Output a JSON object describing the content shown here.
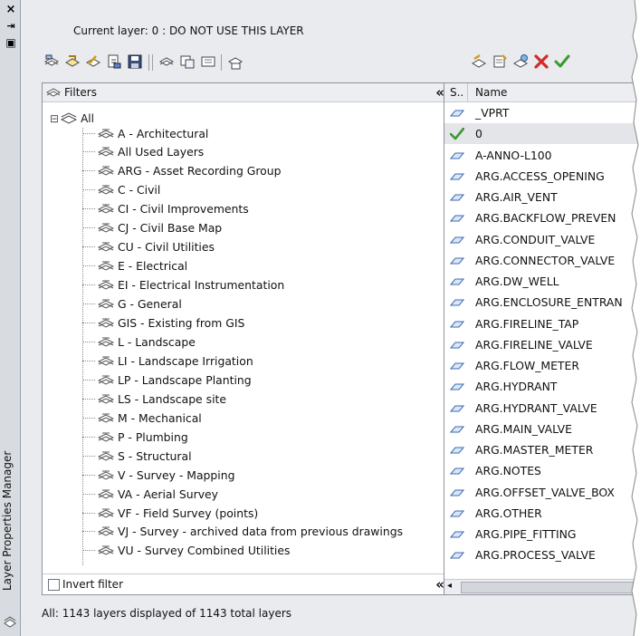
{
  "palette": {
    "title": "Layer Properties Manager",
    "close_glyph": "×",
    "autohide_glyph": "⇥",
    "properties_glyph": "▣"
  },
  "current_layer": "Current layer: 0 : DO NOT USE THIS LAYER",
  "toolbar": {
    "left_icons": [
      "new-property-filter-icon",
      "new-group-filter-icon",
      "layer-states-manager-icon",
      "layer-state-export-icon",
      "save-icon",
      "layer-filter-icon",
      "layer-filter-copy-icon",
      "layer-filter-merge-icon",
      "layer-filter-properties-icon"
    ],
    "right_icons": [
      "new-layer-icon",
      "new-layer-vp-frozen-icon",
      "delete-layer-icon",
      "set-current-icon"
    ],
    "delete_color": "#d12b2b",
    "current_color": "#3a9a2e"
  },
  "filters": {
    "header": "Filters",
    "collapse_glyph": "«",
    "root": "All",
    "expand_glyph": "⊟",
    "items": [
      "A - Architectural",
      "All Used Layers",
      "ARG - Asset Recording Group",
      "C - Civil",
      "CI - Civil Improvements",
      "CJ - Civil Base Map",
      "CU - Civil Utilities",
      "E - Electrical",
      "EI - Electrical Instrumentation",
      "G - General",
      "GIS - Existing from GIS",
      "L - Landscape",
      "LI - Landscape Irrigation",
      "LP - Landscape Planting",
      "LS - Landscape site",
      "M - Mechanical",
      "P - Plumbing",
      "S - Structural",
      "V - Survey - Mapping",
      "VA - Aerial Survey",
      "VF - Field Survey (points)",
      "VJ - Survey - archived data from previous drawings",
      "VU - Survey Combined Utilities"
    ],
    "invert_filter_label": "Invert filter",
    "invert_checked": false
  },
  "layers": {
    "col_status": "S..",
    "col_name": "Name",
    "rows": [
      {
        "name": "_VPRT",
        "current": false
      },
      {
        "name": "0",
        "current": true
      },
      {
        "name": "A-ANNO-L100",
        "current": false
      },
      {
        "name": "ARG.ACCESS_OPENING",
        "current": false
      },
      {
        "name": "ARG.AIR_VENT",
        "current": false
      },
      {
        "name": "ARG.BACKFLOW_PREVEN",
        "current": false
      },
      {
        "name": "ARG.CONDUIT_VALVE",
        "current": false
      },
      {
        "name": "ARG.CONNECTOR_VALVE",
        "current": false
      },
      {
        "name": "ARG.DW_WELL",
        "current": false
      },
      {
        "name": "ARG.ENCLOSURE_ENTRAN",
        "current": false
      },
      {
        "name": "ARG.FIRELINE_TAP",
        "current": false
      },
      {
        "name": "ARG.FIRELINE_VALVE",
        "current": false
      },
      {
        "name": "ARG.FLOW_METER",
        "current": false
      },
      {
        "name": "ARG.HYDRANT",
        "current": false
      },
      {
        "name": "ARG.HYDRANT_VALVE",
        "current": false
      },
      {
        "name": "ARG.MAIN_VALVE",
        "current": false
      },
      {
        "name": "ARG.MASTER_METER",
        "current": false
      },
      {
        "name": "ARG.NOTES",
        "current": false
      },
      {
        "name": "ARG.OFFSET_VALVE_BOX",
        "current": false
      },
      {
        "name": "ARG.OTHER",
        "current": false
      },
      {
        "name": "ARG.PIPE_FITTING",
        "current": false
      },
      {
        "name": "ARG.PROCESS_VALVE",
        "current": false
      }
    ],
    "scroll_left_glyph": "◂"
  },
  "status": "All: 1143 layers displayed of 1143 total layers"
}
